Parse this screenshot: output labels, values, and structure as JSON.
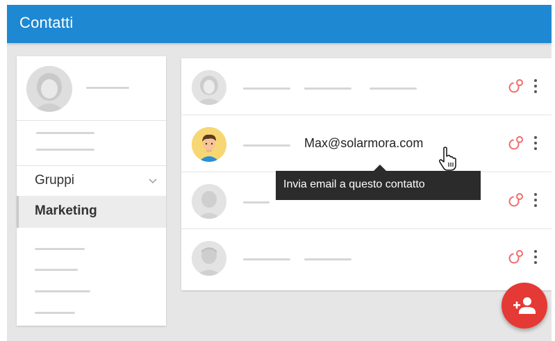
{
  "app": {
    "title": "Contatti"
  },
  "sidebar": {
    "groups_label": "Gruppi",
    "selected_group": "Marketing"
  },
  "contacts": {
    "highlighted_email": "Max@solarmora.com"
  },
  "tooltip": {
    "text": "Invia email a questo contatto"
  },
  "colors": {
    "app_bar": "#1e88d2",
    "accent_red": "#e53935",
    "action_icon": "#ef6c6c",
    "tooltip_bg": "#2b2b2b"
  },
  "icons": {
    "row_action": "send-email-icon",
    "row_menu": "more-vert-icon",
    "fab": "add-person-icon",
    "group_toggle": "chevron-down-icon"
  }
}
